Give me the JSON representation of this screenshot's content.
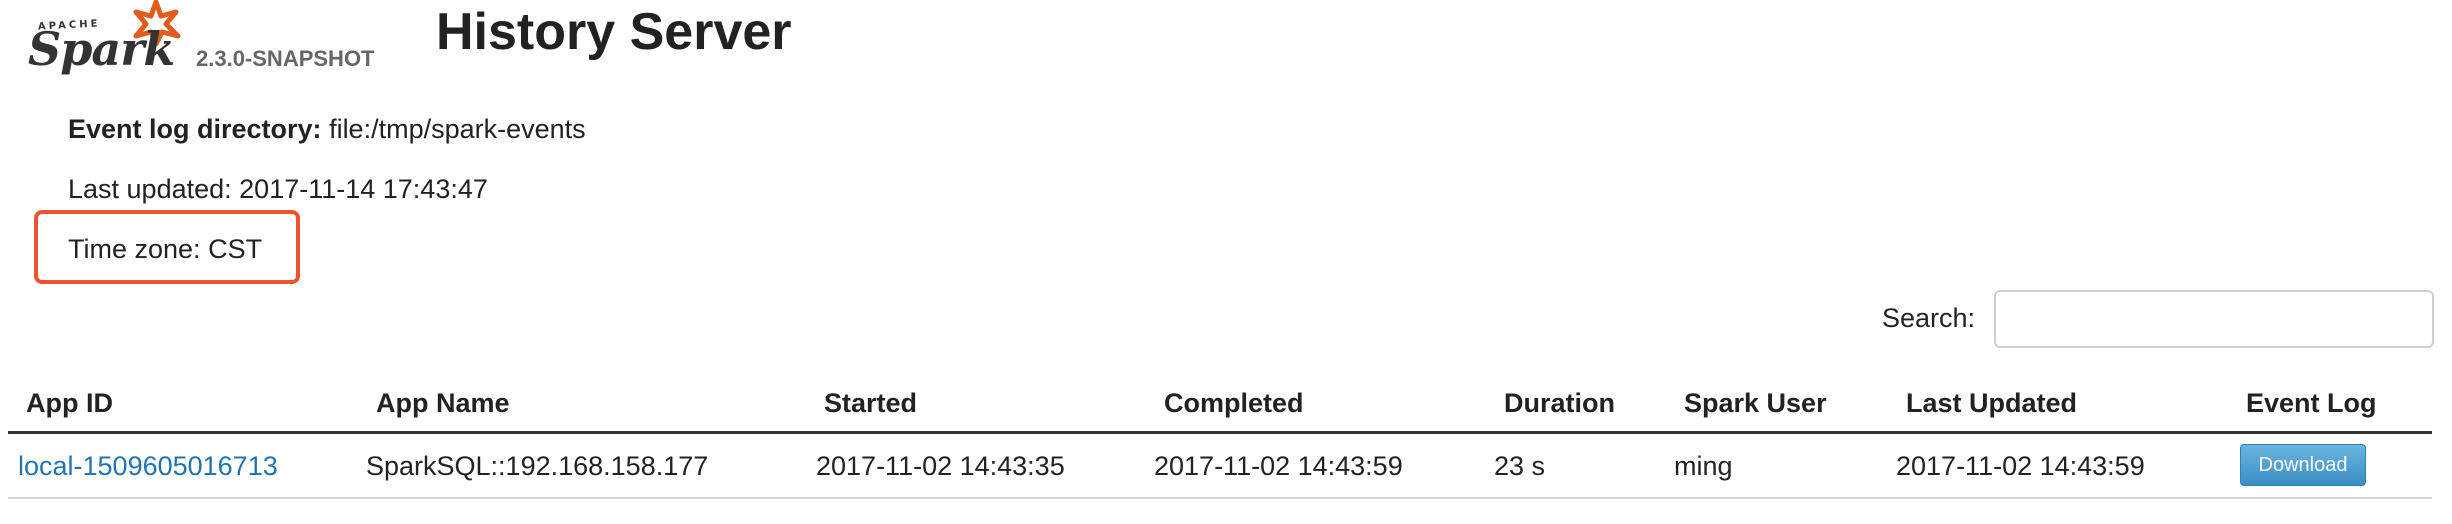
{
  "header": {
    "logo_text": "Spark",
    "logo_small_text": "APACHE",
    "version": "2.3.0-SNAPSHOT",
    "title": "History Server"
  },
  "info": {
    "event_log_label": "Event log directory:",
    "event_log_value": "file:/tmp/spark-events",
    "last_updated_label": "Last updated:",
    "last_updated_value": "2017-11-14 17:43:47",
    "timezone_label": "Time zone:",
    "timezone_value": "CST"
  },
  "search": {
    "label": "Search:",
    "value": ""
  },
  "table": {
    "columns": [
      "App ID",
      "App Name",
      "Started",
      "Completed",
      "Duration",
      "Spark User",
      "Last Updated",
      "Event Log"
    ],
    "rows": [
      {
        "app_id": "local-1509605016713",
        "app_name": "SparkSQL::192.168.158.177",
        "started": "2017-11-02 14:43:35",
        "completed": "2017-11-02 14:43:59",
        "duration": "23 s",
        "spark_user": "ming",
        "last_updated": "2017-11-02 14:43:59",
        "event_log_button": "Download"
      }
    ]
  },
  "colors": {
    "highlight_border": "#e8542d",
    "link": "#2274b0",
    "button": "#3a8ec6",
    "spark_star": "#e25a1c"
  }
}
